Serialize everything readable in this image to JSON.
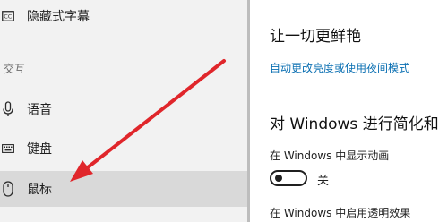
{
  "sidebar": {
    "items_top": [
      {
        "icon": "closed-captions-icon",
        "label": "隐藏式字幕"
      }
    ],
    "section_header": "交互",
    "items": [
      {
        "icon": "microphone-icon",
        "label": "语音"
      },
      {
        "icon": "keyboard-icon",
        "label": "键盘"
      },
      {
        "icon": "mouse-icon",
        "label": "鼠标",
        "selected": true
      }
    ]
  },
  "main": {
    "title": "让一切更鲜艳",
    "link": "自动更改亮度或使用夜间模式",
    "section_title": "对 Windows 进行简化和",
    "animations_label": "在 Windows 中显示动画",
    "animations_toggle_state": "关",
    "transparency_label": "在 Windows 中启用透明效果"
  },
  "colors": {
    "sidebar_bg": "#f2f2f2",
    "selected_bg": "#d9d9d9",
    "link": "#0a6fb2",
    "annotation_arrow": "#e0262b"
  }
}
